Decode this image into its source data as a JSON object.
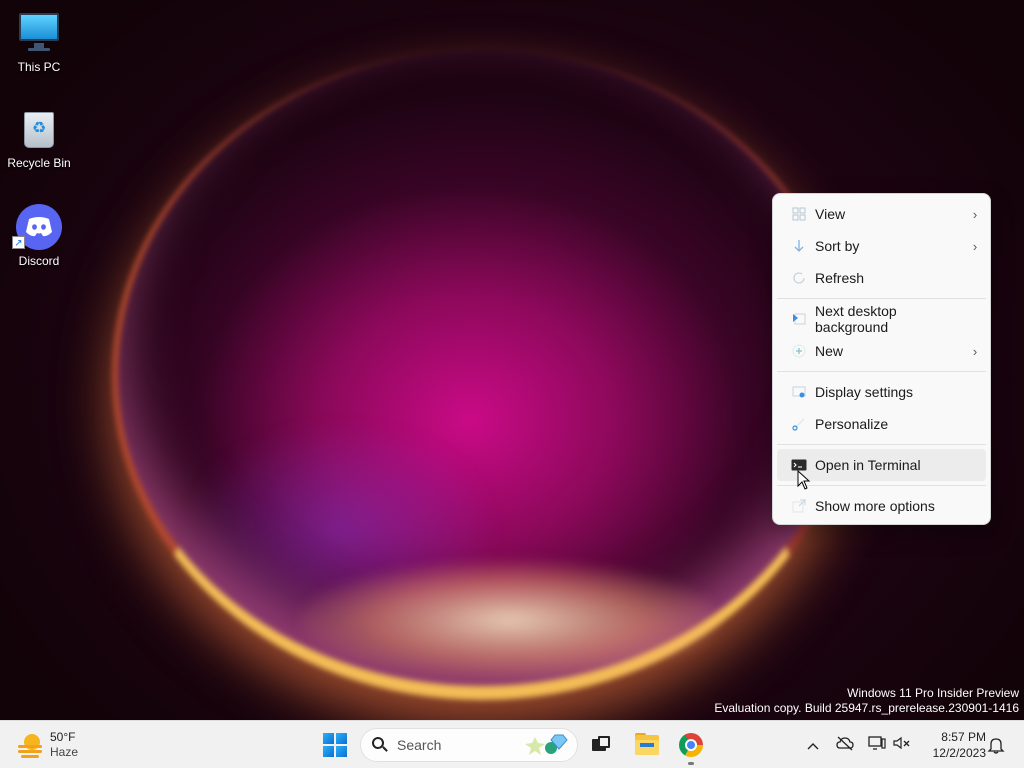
{
  "desktop": {
    "icons": [
      {
        "label": "This PC",
        "icon": "monitor-icon"
      },
      {
        "label": "Recycle Bin",
        "icon": "recycle-bin-icon"
      },
      {
        "label": "Discord",
        "icon": "discord-icon"
      }
    ],
    "watermark": {
      "line1": "Windows 11 Pro Insider Preview",
      "line2": "Evaluation copy. Build 25947.rs_prerelease.230901-1416"
    }
  },
  "context_menu": {
    "items": [
      {
        "label": "View",
        "icon": "grid-icon",
        "submenu": true
      },
      {
        "label": "Sort by",
        "icon": "sort-icon",
        "submenu": true
      },
      {
        "label": "Refresh",
        "icon": "refresh-icon",
        "submenu": false
      },
      {
        "label": "Next desktop background",
        "icon": "next-background-icon",
        "submenu": false
      },
      {
        "label": "New",
        "icon": "plus-icon",
        "submenu": true
      },
      {
        "label": "Display settings",
        "icon": "display-settings-icon",
        "submenu": false
      },
      {
        "label": "Personalize",
        "icon": "brush-icon",
        "submenu": false
      },
      {
        "label": "Open in Terminal",
        "icon": "terminal-icon",
        "submenu": false,
        "hovered": true
      },
      {
        "label": "Show more options",
        "icon": "external-link-icon",
        "submenu": false
      }
    ],
    "chevron": "›"
  },
  "taskbar": {
    "weather": {
      "temp": "50°F",
      "condition": "Haze"
    },
    "search": {
      "placeholder": "Search"
    },
    "apps": [
      "task-view",
      "file-explorer",
      "chrome"
    ],
    "tray": {
      "chevron": "^",
      "time": "8:57 PM",
      "date": "12/2/2023"
    }
  },
  "colors": {
    "menu_bg": "#f9f9f9",
    "taskbar_bg": "#f2f1f1",
    "accent": "#0a6fd6",
    "discord": "#5865f2"
  }
}
